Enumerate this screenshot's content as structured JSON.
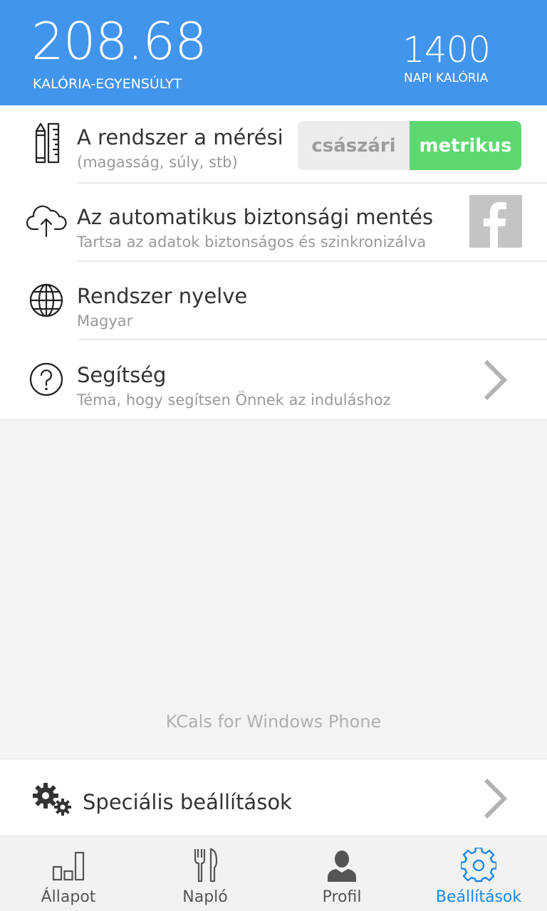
{
  "header": {
    "balance_value": "208.68",
    "balance_label": "KALÓRIA-EGYENSÚLYT",
    "daily_value": "1400",
    "daily_label": "NAPI KALÓRIA",
    "background_color": "#4295ec"
  },
  "settings": {
    "units": {
      "title": "A rendszer a mérési",
      "subtitle": "(magasság, súly, stb)",
      "icon": "ruler-pencil-icon",
      "options": [
        "császári",
        "metrikus"
      ],
      "selected": "metrikus",
      "selected_color": "#5cd86e"
    },
    "backup": {
      "title": "Az automatikus biztonsági mentés",
      "subtitle": "Tartsa az adatok biztonságos és szinkronizálva",
      "icon": "cloud-upload-icon",
      "action_icon": "facebook-icon"
    },
    "language": {
      "title": "Rendszer nyelve",
      "subtitle": "Magyar",
      "icon": "globe-icon"
    },
    "help": {
      "title": "Segítség",
      "subtitle": "Téma, hogy segítsen Önnek az induláshoz",
      "icon": "question-icon"
    }
  },
  "footer_text": "KCals for Windows Phone",
  "special_settings": {
    "label": "Speciális beállítások",
    "icon": "gears-icon"
  },
  "nav": {
    "items": [
      {
        "label": "Állapot",
        "icon": "bar-chart-icon"
      },
      {
        "label": "Napló",
        "icon": "fork-knife-icon"
      },
      {
        "label": "Profil",
        "icon": "person-icon"
      },
      {
        "label": "Beállítások",
        "icon": "gear-icon"
      }
    ],
    "active": "Beállítások",
    "active_color": "#1e86e6"
  }
}
